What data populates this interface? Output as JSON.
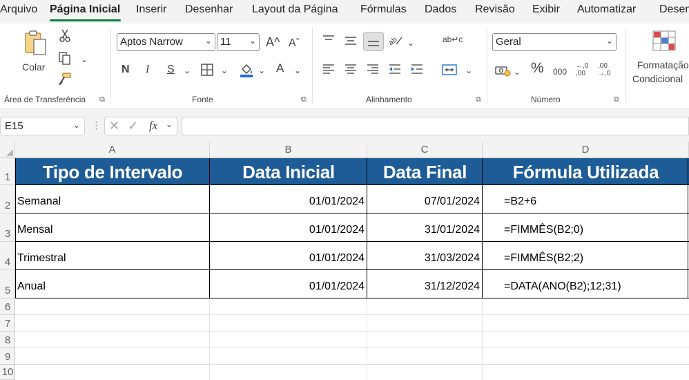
{
  "menu": {
    "tabs": [
      "Arquivo",
      "Página Inicial",
      "Inserir",
      "Desenhar",
      "Layout da Página",
      "Fórmulas",
      "Dados",
      "Revisão",
      "Exibir",
      "Automatizar",
      "Desen"
    ],
    "active_index": 1
  },
  "ribbon": {
    "clipboard": {
      "paste_label": "Colar",
      "group_label": "Área de Transferência"
    },
    "font": {
      "font_name": "Aptos Narrow",
      "font_size": "11",
      "bold": "N",
      "italic": "I",
      "underline": "S",
      "grow": "A^",
      "shrink": "Aˇ",
      "font_color_letter": "A",
      "group_label": "Fonte"
    },
    "alignment": {
      "group_label": "Alinhamento",
      "wrap_text_icon": "ab↵c"
    },
    "number": {
      "format": "Geral",
      "percent": "%",
      "thousands": "000",
      "inc_decimal": "←,0 ,00",
      "dec_decimal": ",00 →,0",
      "group_label": "Número"
    },
    "styles": {
      "conditional_line1": "Formatação",
      "conditional_line2": "Condicional"
    }
  },
  "formula_bar": {
    "name_box": "E15",
    "fx": "fx",
    "formula": ""
  },
  "sheet": {
    "columns": [
      "A",
      "B",
      "C",
      "D"
    ],
    "rows": [
      "1",
      "2",
      "3",
      "4",
      "5",
      "6",
      "7",
      "8",
      "9",
      "10"
    ],
    "headers": [
      "Tipo de Intervalo",
      "Data Inicial",
      "Data Final",
      "Fórmula Utilizada"
    ],
    "data": [
      {
        "tipo": "Semanal",
        "inicial": "01/01/2024",
        "final": "07/01/2024",
        "formula": "=B2+6"
      },
      {
        "tipo": "Mensal",
        "inicial": "01/01/2024",
        "final": "31/01/2024",
        "formula": "=FIMMÊS(B2;0)"
      },
      {
        "tipo": "Trimestral",
        "inicial": "01/01/2024",
        "final": "31/03/2024",
        "formula": "=FIMMÊS(B2;2)"
      },
      {
        "tipo": "Anual",
        "inicial": "01/01/2024",
        "final": "31/12/2024",
        "formula": "=DATA(ANO(B2);12;31)"
      }
    ],
    "header_fill": "#1e5c97",
    "header_text_color": "#ffffff"
  },
  "colors": {
    "accent": "#107c41"
  }
}
